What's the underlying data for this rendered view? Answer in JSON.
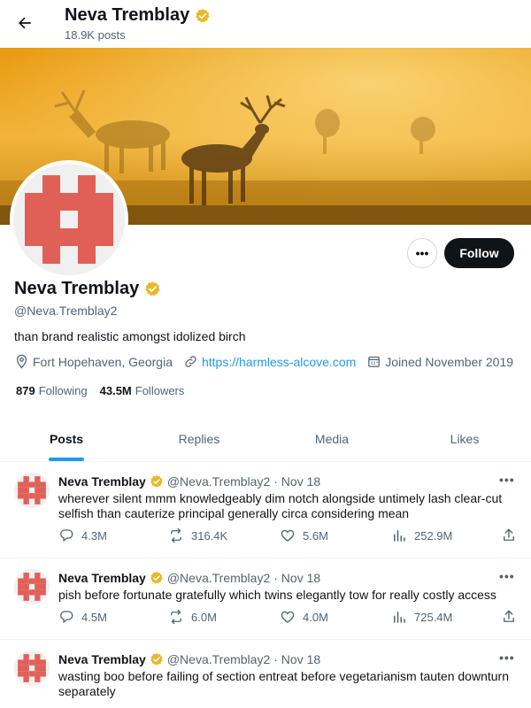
{
  "header": {
    "name": "Neva Tremblay",
    "posts_count": "18.9K posts"
  },
  "profile": {
    "name": "Neva Tremblay",
    "handle": "@Neva.Tremblay2",
    "bio": "than brand realistic amongst idolized birch",
    "location": "Fort Hopehaven, Georgia",
    "website": "https://harmless-alcove.com",
    "joined": "Joined November 2019",
    "following_count": "879",
    "following_label": "Following",
    "followers_count": "43.5M",
    "followers_label": "Followers",
    "follow_label": "Follow",
    "more_label": "•••"
  },
  "tabs": [
    {
      "label": "Posts"
    },
    {
      "label": "Replies"
    },
    {
      "label": "Media"
    },
    {
      "label": "Likes"
    }
  ],
  "tweets": [
    {
      "name": "Neva Tremblay",
      "handle": "@Neva.Tremblay2",
      "date": "· Nov 18",
      "text": "wherever silent mmm knowledgeably dim notch alongside untimely lash clear-cut selfish than cauterize principal generally circa considering mean",
      "replies": "4.3M",
      "reposts": "316.4K",
      "likes": "5.6M",
      "views": "252.9M"
    },
    {
      "name": "Neva Tremblay",
      "handle": "@Neva.Tremblay2",
      "date": "· Nov 18",
      "text": "pish before fortunate gratefully which twins elegantly tow for really costly access",
      "replies": "4.5M",
      "reposts": "6.0M",
      "likes": "4.0M",
      "views": "725.4M"
    },
    {
      "name": "Neva Tremblay",
      "handle": "@Neva.Tremblay2",
      "date": "· Nov 18",
      "text": "wasting boo before failing of section entreat before vegetarianism tauten downturn separately",
      "replies": "",
      "reposts": "",
      "likes": "",
      "views": ""
    }
  ],
  "colors": {
    "accent": "#1d9bf0",
    "verified": "#e8b829",
    "avatar_red": "#e06058"
  },
  "icons": [
    "back-arrow-icon",
    "verified-badge-icon",
    "location-icon",
    "link-icon",
    "calendar-icon",
    "reply-icon",
    "repost-icon",
    "like-icon",
    "views-icon",
    "share-icon"
  ]
}
